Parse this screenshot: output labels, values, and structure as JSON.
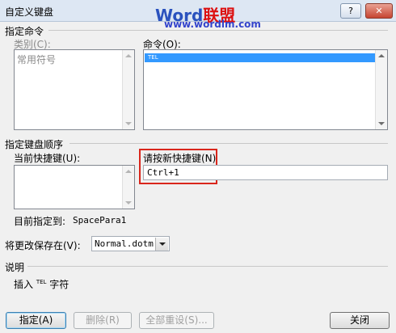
{
  "window": {
    "title": "自定义键盘",
    "help_label": "?",
    "close_label": "✕"
  },
  "watermark": {
    "word": "Word",
    "cn": "联盟",
    "url": "www.wordlm.com"
  },
  "specify_command": {
    "heading": "指定命令",
    "categories_label": "类别(C):",
    "categories": [
      "常用符号"
    ],
    "commands_label": "命令(O):",
    "commands": [
      {
        "label": "TEL",
        "selected": true
      }
    ]
  },
  "keyboard_sequence": {
    "heading": "指定键盘顺序",
    "current_keys_label": "当前快捷键(U):",
    "current_keys": [],
    "new_key_label": "请按新快捷键(N)",
    "new_key_value": "Ctrl+1",
    "assigned_to_label": "目前指定到:",
    "assigned_to_value": "SpacePara1"
  },
  "save_changes": {
    "label": "将更改保存在(V):",
    "value": "Normal.dotm"
  },
  "description": {
    "heading": "说明",
    "prefix": "插入",
    "symbol": "TEL",
    "suffix": "字符"
  },
  "buttons": {
    "assign": "指定(A)",
    "remove": "删除(R)",
    "reset_all": "全部重设(S)...",
    "close": "关闭"
  },
  "colors": {
    "highlight_border": "#d9261c",
    "selection": "#3399ff"
  }
}
